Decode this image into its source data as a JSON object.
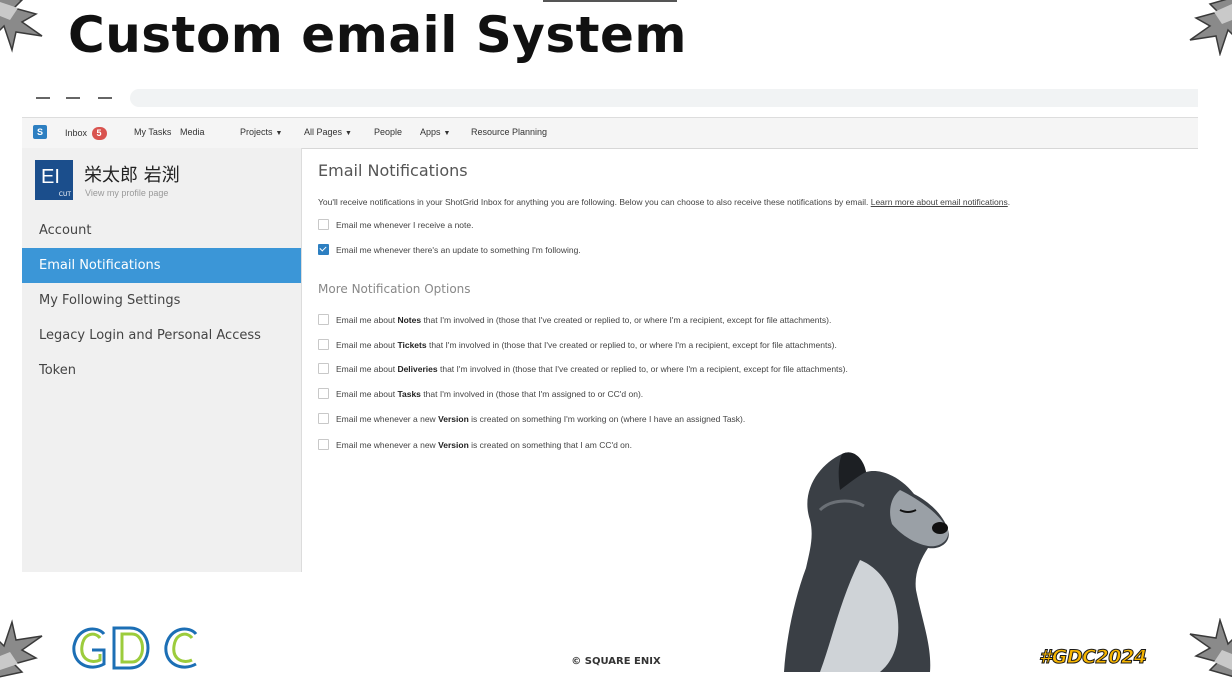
{
  "slide": {
    "title": "Custom email System",
    "copyright": "© SQUARE ENIX",
    "hashtag": "#GDC2024"
  },
  "appnav": {
    "logo_letter": "S",
    "inbox_label": "Inbox",
    "inbox_count": "5",
    "items": [
      "My Tasks",
      "Media",
      "Projects",
      "All Pages",
      "People",
      "Apps",
      "Resource Planning"
    ]
  },
  "sidebar": {
    "avatar_initials": "EI",
    "avatar_tag": "CUT",
    "profile_name": "栄太郎 岩渕",
    "profile_link": "View my profile page",
    "items": [
      "Account",
      "Email Notifications",
      "My Following Settings",
      "Legacy Login and Personal Access Token"
    ],
    "active_index": 1
  },
  "main": {
    "heading": "Email Notifications",
    "intro_text": "You'll receive notifications in your ShotGrid Inbox for anything you are following. Below you can choose to also receive these notifications by email.",
    "intro_link": "Learn more about email notifications",
    "intro_end": ".",
    "options": [
      {
        "text": "Email me whenever I receive a note.",
        "checked": false
      },
      {
        "text": "Email me whenever there's an update to something I'm following.",
        "checked": true
      }
    ],
    "more_heading": "More Notification Options",
    "more_options": [
      {
        "pre": "Email me about",
        "bold": "Notes",
        "post": "that I'm involved in (those that I've created or replied to, or where I'm a recipient, except for file attachments).",
        "checked": false
      },
      {
        "pre": "Email me about",
        "bold": "Tickets",
        "post": "that I'm involved in (those that I've created or replied to, or where I'm a recipient, except for file attachments).",
        "checked": false
      },
      {
        "pre": "Email me about",
        "bold": "Deliveries",
        "post": "that I'm involved in (those that I've created or replied to, or where I'm a recipient, except for file attachments).",
        "checked": false
      },
      {
        "pre": "Email me about",
        "bold": "Tasks",
        "post": "that I'm involved in (those that I'm assigned to or CC'd on).",
        "checked": false
      },
      {
        "pre": "Email me whenever a new",
        "bold": "Version",
        "post": "is created on something I'm working on (where I have an assigned Task).",
        "checked": false
      },
      {
        "pre": "Email me whenever a new",
        "bold": "Version",
        "post": "is created on something that I am CC'd on.",
        "checked": false
      }
    ]
  },
  "colors": {
    "accent": "#3b96d7",
    "badge": "#d9534f",
    "avatar": "#1b4e8c",
    "hashtag": "#f7b500"
  }
}
